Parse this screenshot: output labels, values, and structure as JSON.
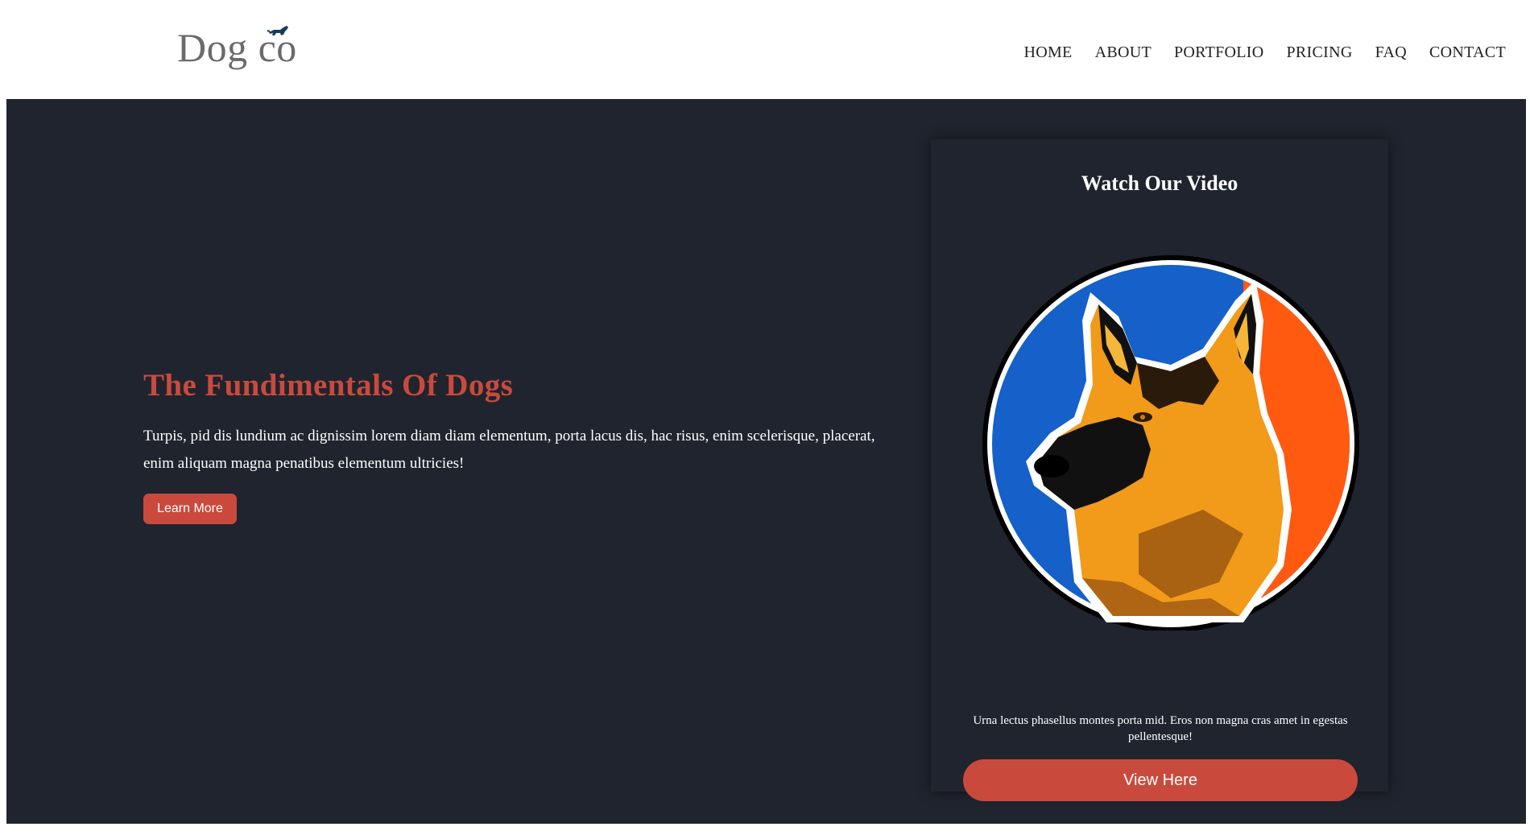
{
  "header": {
    "logo_text": "Dog co",
    "logo_icon": "running-dog-icon",
    "nav": [
      "HOME",
      "ABOUT",
      "PORTFOLIO",
      "PRICING",
      "FAQ",
      "CONTACT"
    ]
  },
  "hero": {
    "title": "The Fundimentals Of Dogs",
    "text": "Turpis, pid dis lundium ac dignissim lorem diam diam elementum, porta lacus dis, hac risus, enim scelerisque, placerat, enim aliquam magna penatibus elementum ultricies!",
    "button_label": "Learn More"
  },
  "video_card": {
    "title": "Watch Our Video",
    "image_icon": "german-shepherd-logo-icon",
    "text": "Urna lectus phasellus montes porta mid. Eros non magna cras amet in egestas pellentesque!",
    "button_label": "View Here"
  },
  "colors": {
    "accent": "#c94a3d",
    "hero_background": "#20242e",
    "header_background": "#ffffff",
    "logo_circle_blue": "#1560c9",
    "logo_circle_orange": "#ff5a10"
  }
}
